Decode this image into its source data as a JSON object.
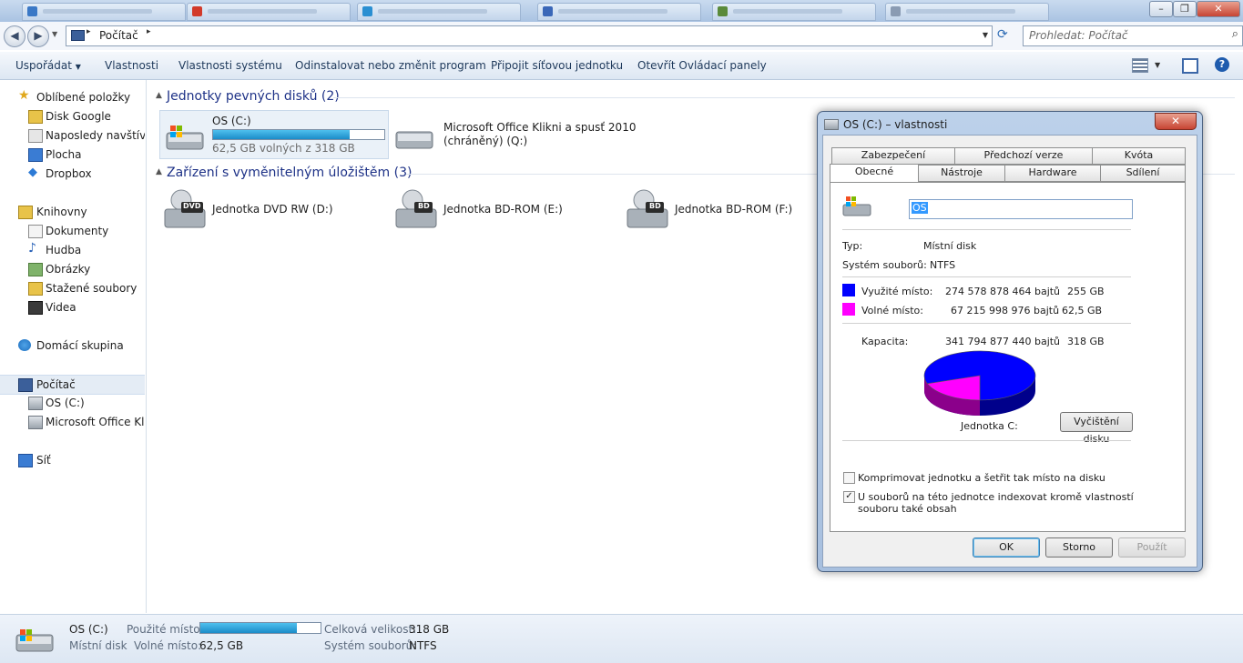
{
  "colors": {
    "used_space": "#0000ff",
    "free_space": "#ff00ff",
    "capacity_bar": "#26a0da"
  },
  "address": {
    "path": "Počítač",
    "search_placeholder": "Prohledat: Počítač"
  },
  "commands": [
    "Uspořádat",
    "Vlastnosti",
    "Vlastnosti systému",
    "Odinstalovat nebo změnit program",
    "Připojit síťovou jednotku",
    "Otevřít Ovládací panely"
  ],
  "nav": {
    "favorites": "Oblíbené položky",
    "disk_google": "Disk Google",
    "recent": "Naposledy navštíven",
    "desktop": "Plocha",
    "dropbox": "Dropbox",
    "libraries": "Knihovny",
    "documents": "Dokumenty",
    "music": "Hudba",
    "pictures": "Obrázky",
    "downloads": "Stažené soubory",
    "videos": "Videa",
    "homegroup": "Domácí skupina",
    "computer": "Počítač",
    "os_c": "OS (C:)",
    "office": "Microsoft Office Klik",
    "network": "Síť"
  },
  "hard_disks": {
    "header": "Jednotky pevných disků (2)",
    "c_name": "OS (C:)",
    "c_free": "62,5 GB volných z 318 GB",
    "c_used_fraction": 0.8,
    "q_line1": "Microsoft Office Klikni a spusť 2010",
    "q_line2": "(chráněný) (Q:)"
  },
  "removable": {
    "header": "Zařízení s vyměnitelným úložištěm (3)",
    "dvd": "Jednotka DVD RW (D:)",
    "bd_e": "Jednotka BD-ROM (E:)",
    "bd_f": "Jednotka BD-ROM (F:)",
    "dvd_badge": "DVD",
    "bd_badge": "BD"
  },
  "dialog": {
    "title": "OS (C:) – vlastnosti",
    "tabs_back": [
      "Zabezpečení",
      "Předchozí verze",
      "Kvóta"
    ],
    "tabs_front": [
      "Obecné",
      "Nástroje",
      "Hardware",
      "Sdílení"
    ],
    "name_value": "OS",
    "type_label": "Typ:",
    "type_value": "Místní disk",
    "fs_label": "Systém souborů:",
    "fs_value": "NTFS",
    "used_label": "Využité místo:",
    "used_bytes": "274 578 878 464 bajtů",
    "used_gb": "255 GB",
    "free_label": "Volné místo:",
    "free_bytes": "67 215 998 976 bajtů",
    "free_gb": "62,5 GB",
    "cap_label": "Kapacita:",
    "cap_bytes": "341 794 877 440 bajtů",
    "cap_gb": "318 GB",
    "drive_label": "Jednotka C:",
    "cleanup_button": "Vyčištění disku",
    "compress_label": "Komprimovat jednotku a šetřit tak místo na disku",
    "compress_checked": false,
    "index_label_1": "U souborů na této jednotce indexovat kromě vlastností",
    "index_label_2": "souboru také obsah",
    "index_checked": true,
    "ok": "OK",
    "cancel": "Storno",
    "apply": "Použít"
  },
  "status": {
    "name": "OS (C:)",
    "type": "Místní disk",
    "used_label": "Použité místo:",
    "free_label": "Volné místo:",
    "free_value": "62,5 GB",
    "total_label": "Celková velikost:",
    "total_value": "318 GB",
    "fs_label": "Systém souborů:",
    "fs_value": "NTFS",
    "used_fraction": 0.8
  }
}
